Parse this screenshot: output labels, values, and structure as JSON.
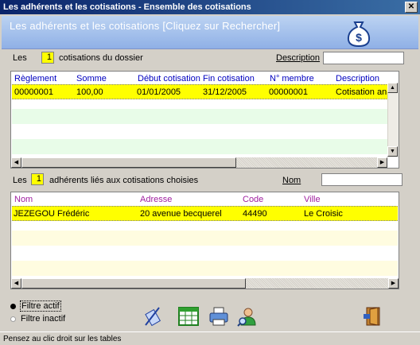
{
  "window": {
    "title": "Les adhérents et les cotisations - Ensemble des cotisations",
    "close_label": "✕"
  },
  "banner": {
    "title": "Les adhérents et les cotisations [Cliquez sur Rechercher]",
    "icon": "money-bag-icon"
  },
  "cotisations": {
    "prefix": "Les",
    "count": "1",
    "suffix": "cotisations du dossier",
    "filter_label": "Description",
    "filter_value": "",
    "columns": [
      "Règlement",
      "Somme",
      "Début cotisation",
      "Fin cotisation",
      "N° membre",
      "Description"
    ],
    "rows": [
      [
        "00000001",
        "100,00",
        "01/01/2005",
        "31/12/2005",
        "00000001",
        "Cotisation annue"
      ]
    ]
  },
  "adherents": {
    "prefix": "Les",
    "count": "1",
    "suffix": "adhérents liés aux cotisations choisies",
    "filter_label": "Nom",
    "filter_value": "",
    "columns": [
      "Nom",
      "Adresse",
      "Code",
      "Ville"
    ],
    "rows": [
      [
        "JEZEGOU Frédéric",
        "20 avenue becquerel",
        "44490",
        "Le Croisic"
      ]
    ]
  },
  "filters": {
    "active": "Filtre actif",
    "inactive": "Filtre inactif"
  },
  "toolbar": [
    "calculator-pen-icon",
    "spreadsheet-icon",
    "printer-icon",
    "user-search-icon",
    "exit-door-icon"
  ],
  "status": "Pensez au clic droit sur les tables",
  "colors": {
    "selected_row": "#ffff00",
    "cotis_alt_row": "#e8fce8",
    "adh_alt_row": "#fffce0",
    "header_text": "#0000c0"
  }
}
